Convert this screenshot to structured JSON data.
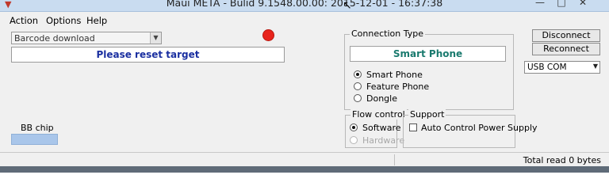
{
  "window": {
    "title": "Maui META - Bulid 9.1548.00.00: 2015-12-01 - 16:37:38",
    "icon": "app-icon",
    "controls": [
      "minimize-icon",
      "maximize-icon",
      "close-icon"
    ]
  },
  "menu": {
    "items": [
      {
        "label": "Action"
      },
      {
        "label": "Options"
      },
      {
        "label": "Help"
      }
    ]
  },
  "mode_combo": {
    "value": "Barcode download"
  },
  "indicator": {
    "color": "#e8241c"
  },
  "status_message": "Please reset target",
  "bb_chip": {
    "label": "BB chip"
  },
  "connection": {
    "group_title": "Connection Type",
    "display": "Smart Phone",
    "options": [
      {
        "label": "Smart Phone",
        "selected": true
      },
      {
        "label": "Feature Phone",
        "selected": false
      },
      {
        "label": "Dongle",
        "selected": false
      }
    ]
  },
  "flow_control": {
    "group_title": "Flow control",
    "options": [
      {
        "label": "Software",
        "selected": true,
        "enabled": true
      },
      {
        "label": "Hardware",
        "selected": false,
        "enabled": false
      }
    ]
  },
  "support": {
    "group_title": "Support",
    "checkbox_label": "Auto Control Power Supply",
    "checked": false
  },
  "buttons": {
    "disconnect": "Disconnect",
    "reconnect": "Reconnect"
  },
  "port_combo": {
    "value": "USB COM"
  },
  "statusbar": {
    "text": "Total read 0 bytes"
  },
  "colors": {
    "status_text": "#1a2fa0",
    "smart_phone_text": "#1a7a6e",
    "bb_chip_bar": "#a9c6ea"
  }
}
